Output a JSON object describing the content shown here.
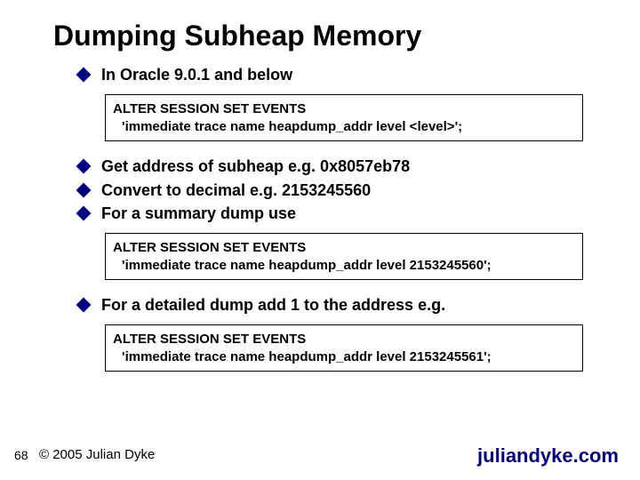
{
  "title": "Dumping Subheap Memory",
  "bullets": {
    "b1": "In Oracle 9.0.1 and below",
    "b2": "Get address of subheap e.g. 0x8057eb78",
    "b3": "Convert to decimal e.g. 2153245560",
    "b4": "For a summary dump use",
    "b5": "For a detailed dump add 1 to the address e.g."
  },
  "code1": {
    "l1": "ALTER SESSION SET EVENTS",
    "l2": "'immediate trace name heapdump_addr level <level>';"
  },
  "code2": {
    "l1": "ALTER SESSION SET EVENTS",
    "l2": "'immediate trace name heapdump_addr level 2153245560';"
  },
  "code3": {
    "l1": "ALTER SESSION SET EVENTS",
    "l2": "'immediate trace name heapdump_addr level 2153245561';"
  },
  "footer": {
    "page": "68",
    "copyright": "© 2005 Julian Dyke",
    "site": "juliandyke.com"
  }
}
